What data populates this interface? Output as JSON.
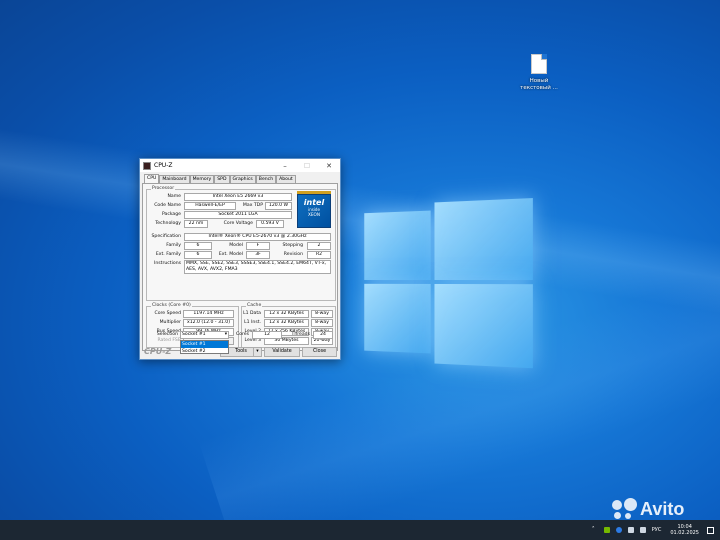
{
  "desktop": {
    "icon_label": "Новый текстовый ..."
  },
  "window": {
    "title": "CPU-Z",
    "tabs": [
      "CPU",
      "Mainboard",
      "Memory",
      "SPD",
      "Graphics",
      "Bench",
      "About"
    ]
  },
  "processor": {
    "group_label": "Processor",
    "name_label": "Name",
    "name": "Intel Xeon E5 2669 v3",
    "code_name_label": "Code Name",
    "code_name": "Haswell-E/EP",
    "max_tdp_label": "Max TDP",
    "max_tdp": "120.0 W",
    "package_label": "Package",
    "package": "Socket 2011 LGA",
    "technology_label": "Technology",
    "technology": "22 nm",
    "core_voltage_label": "Core Voltage",
    "core_voltage": "0.593 V",
    "specification_label": "Specification",
    "specification": "Intel® Xeon® CPU E5-2670 v3 @ 2.30GHz",
    "family_label": "Family",
    "family": "6",
    "model_label": "Model",
    "model": "F",
    "stepping_label": "Stepping",
    "stepping": "2",
    "ext_family_label": "Ext. Family",
    "ext_family": "6",
    "ext_model_label": "Ext. Model",
    "ext_model": "3F",
    "revision_label": "Revision",
    "revision": "R2",
    "instructions_label": "Instructions",
    "instructions_line1": "MMX, SSE, SSE2, SSE3, SSSE3, SSE4.1, SSE4.2, EM64T, VT-x,",
    "instructions_line2": "AES, AVX, AVX2, FMA3",
    "logo_brand": "intel",
    "logo_inside": "inside",
    "logo_line": "XEON"
  },
  "clocks": {
    "group_label": "Clocks (Core #0)",
    "core_speed_label": "Core Speed",
    "core_speed": "1197.14 MHz",
    "multiplier_label": "Multiplier",
    "multiplier": "x12.0 (12.0 - 31.0)",
    "bus_speed_label": "Bus Speed",
    "bus_speed": "99.76 MHz",
    "rated_fsb_label": "Rated FSB",
    "rated_fsb": ""
  },
  "cache": {
    "group_label": "Cache",
    "l1_data_label": "L1 Data",
    "l1_data": "12 x 32 KBytes",
    "l1_data_way": "8-way",
    "l1_inst_label": "L1 Inst.",
    "l1_inst": "12 x 32 KBytes",
    "l1_inst_way": "8-way",
    "level2_label": "Level 2",
    "level2": "12 x 256 KBytes",
    "level2_way": "8-way",
    "level3_label": "Level 3",
    "level3": "30 MBytes",
    "level3_way": "20-way"
  },
  "selection": {
    "label": "Selection",
    "value": "Socket #1",
    "cores_label": "Cores",
    "cores": "12",
    "threads_label": "Threads",
    "threads": "24",
    "options": [
      "Socket #1",
      "Socket #2"
    ]
  },
  "bottom": {
    "brand": "CPU-Z",
    "version": "Ver. 2.01.0.x64",
    "tools_label": "Tools",
    "validate_label": "Validate",
    "close_label": "Close"
  },
  "taskbar": {
    "language": "РУС",
    "time": "10:04",
    "date": "01.02.2025"
  },
  "watermark": "Avito",
  "colors": {
    "accent": "#0078d7",
    "taskbar": "#1c2733"
  }
}
